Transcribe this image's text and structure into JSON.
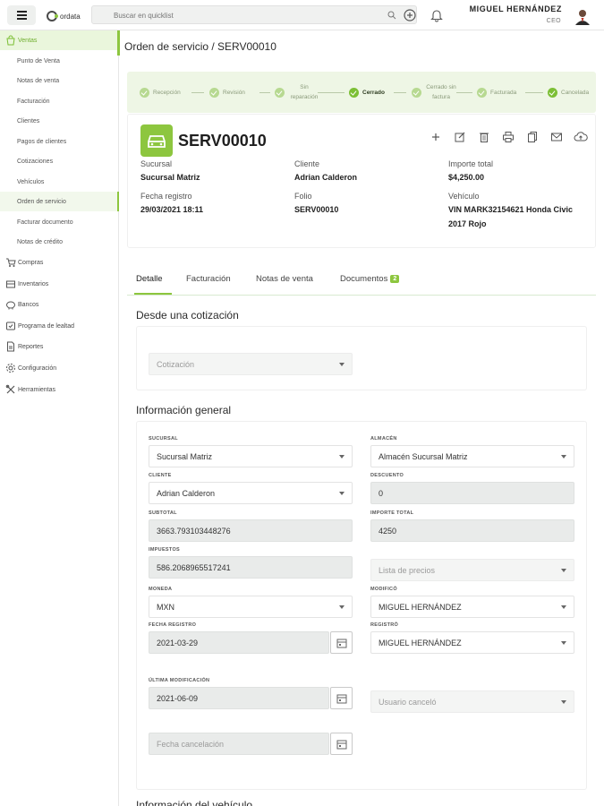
{
  "topbar": {
    "logo_text": "ordata",
    "search_placeholder": "Buscar en quicklist",
    "user_name": "MIGUEL HERNÁNDEZ",
    "user_role": "CEO"
  },
  "sidebar": {
    "items": [
      {
        "label": "Ventas",
        "icon": "shopping-bag-icon",
        "level": "top",
        "state": "active-parent"
      },
      {
        "label": "Punto de Venta",
        "level": "sub"
      },
      {
        "label": "Notas de venta",
        "level": "sub"
      },
      {
        "label": "Facturación",
        "level": "sub"
      },
      {
        "label": "Clientes",
        "level": "sub"
      },
      {
        "label": "Pagos de clientes",
        "level": "sub"
      },
      {
        "label": "Cotizaciones",
        "level": "sub"
      },
      {
        "label": "Vehículos",
        "level": "sub"
      },
      {
        "label": "Orden de servicio",
        "level": "sub",
        "state": "active"
      },
      {
        "label": "Facturar documento",
        "level": "sub"
      },
      {
        "label": "Notas de crédito",
        "level": "sub"
      },
      {
        "label": "Compras",
        "icon": "cart-icon",
        "level": "top"
      },
      {
        "label": "Inventarios",
        "icon": "inventory-icon",
        "level": "top"
      },
      {
        "label": "Bancos",
        "icon": "piggy-bank-icon",
        "level": "top"
      },
      {
        "label": "Programa de lealtad",
        "icon": "loyalty-icon",
        "level": "top"
      },
      {
        "label": "Reportes",
        "icon": "report-icon",
        "level": "top"
      },
      {
        "label": "Configuración",
        "icon": "gear-icon",
        "level": "top"
      },
      {
        "label": "Herramientas",
        "icon": "tools-icon",
        "level": "top"
      }
    ]
  },
  "page": {
    "title": "Orden de servicio / SERV00010"
  },
  "stepper": {
    "steps": [
      {
        "label": "Recepción",
        "done": false
      },
      {
        "label": "Revisión",
        "done": false
      },
      {
        "label": "Sin reparación",
        "done": false
      },
      {
        "label": "Cerrado",
        "done": true
      },
      {
        "label": "Cerrado sin factura",
        "done": false
      },
      {
        "label": "Facturada",
        "done": false
      },
      {
        "label": "Cancelada",
        "done": false
      }
    ]
  },
  "document": {
    "number": "SERV00010",
    "sucursal_label": "Sucursal",
    "sucursal": "Sucursal Matriz",
    "cliente_label": "Cliente",
    "cliente": "Adrian Calderon",
    "importe_label": "Importe total",
    "importe": "$4,250.00",
    "fecha_label": "Fecha registro",
    "fecha": "29/03/2021 18:11",
    "folio_label": "Folio",
    "folio": "SERV00010",
    "vehiculo_label": "Vehículo",
    "vehiculo": "VIN MARK32154621 Honda Civic 2017 Rojo"
  },
  "tabs": [
    {
      "label": "Detalle",
      "active": true
    },
    {
      "label": "Facturación"
    },
    {
      "label": "Notas de venta"
    },
    {
      "label": "Documentos",
      "badge": "2"
    }
  ],
  "cotizacion_section": {
    "title": "Desde una cotización",
    "select_placeholder": "Cotización"
  },
  "general_section": {
    "title": "Información general",
    "sucursal_label": "Sucursal",
    "sucursal": "Sucursal Matriz",
    "almacen_label": "Almacén",
    "almacen": "Almacén Sucursal Matriz",
    "cliente_label": "Cliente",
    "cliente": "Adrian Calderon",
    "descuento_label": "Descuento",
    "descuento": "0",
    "subtotal_label": "Subtotal",
    "subtotal": "3663.793103448276",
    "importe_label": "Importe total",
    "importe": "4250",
    "impuestos_label": "Impuestos",
    "impuestos": "586.2068965517241",
    "lista_precios_placeholder": "Lista de precios",
    "moneda_label": "Moneda",
    "moneda": "MXN",
    "modifico_label": "Modificó",
    "modifico": "MIGUEL HERNÁNDEZ",
    "fecha_registro_label": "Fecha registro",
    "fecha_registro": "2021-03-29",
    "registro_label": "Registró",
    "registro": "MIGUEL HERNÁNDEZ",
    "ultima_mod_label": "Última modificación",
    "ultima_mod": "2021-06-09",
    "usuario_cancelo_placeholder": "Usuario canceló",
    "fecha_cancelacion_placeholder": "Fecha cancelación"
  },
  "next_section": {
    "title": "Información del vehículo"
  },
  "colors": {
    "accent": "#8dc63f",
    "stepper_bg": "#eef6e5",
    "readonly_bg": "#e9ebea"
  }
}
